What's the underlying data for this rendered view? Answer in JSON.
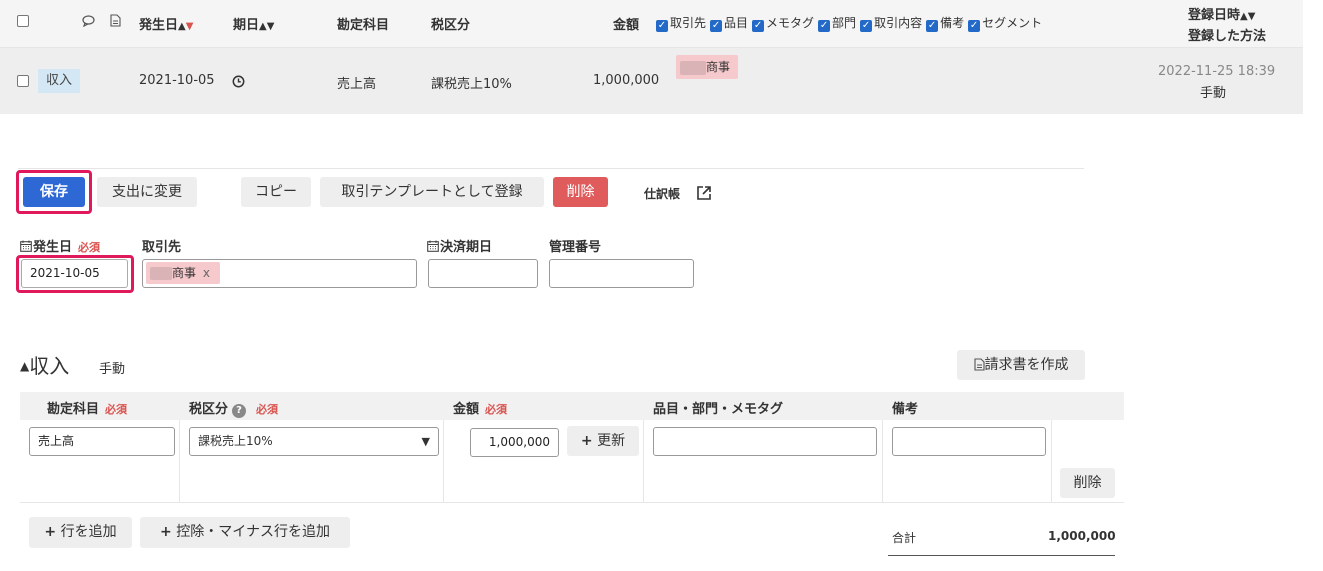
{
  "list_header": {
    "columns": {
      "occurrence_date": "発生日",
      "due_date": "期日",
      "account": "勘定科目",
      "tax_type": "税区分",
      "amount": "金額",
      "registered_at": "登録日時",
      "registration_method": "登録した方法"
    },
    "toggles": [
      "取引先",
      "品目",
      "メモタグ",
      "部門",
      "取引内容",
      "備考",
      "セグメント"
    ]
  },
  "list_row": {
    "type": "収入",
    "occurrence_date": "2021-10-05",
    "account": "売上高",
    "tax_type": "課税売上10%",
    "amount": "1,000,000",
    "partner_suffix": "商事",
    "registered_at": "2022-11-25 18:39",
    "registration_method": "手動"
  },
  "toolbar": {
    "save": "保存",
    "change_to_expense": "支出に変更",
    "copy": "コピー",
    "register_template": "取引テンプレートとして登録",
    "delete": "削除",
    "journal": "仕訳帳"
  },
  "form": {
    "occurrence_date_label": "発生日",
    "required": "必須",
    "occurrence_date_value": "2021-10-05",
    "partner_label": "取引先",
    "partner_suffix": "商事",
    "partner_remove": "x",
    "settlement_due_label": "決済期日",
    "control_number_label": "管理番号"
  },
  "detail": {
    "section_title": "収入",
    "section_method": "手動",
    "create_invoice": "請求書を作成",
    "headers": {
      "account": "勘定科目",
      "tax_type": "税区分",
      "amount": "金額",
      "items": "品目・部門・メモタグ",
      "remarks": "備考"
    },
    "row": {
      "account": "売上高",
      "tax_type": "課税売上10%",
      "amount": "1,000,000",
      "update": "更新",
      "delete": "削除"
    },
    "add_row": "行を追加",
    "add_minus_row": "控除・マイナス行を追加",
    "total_label": "合計",
    "total_value": "1,000,000"
  },
  "colors": {
    "primary": "#2d68d4",
    "danger": "#e05c5c",
    "highlight": "#e0195a",
    "partner_tag": "#f6c9cc",
    "income_badge": "#d3e7f5"
  }
}
